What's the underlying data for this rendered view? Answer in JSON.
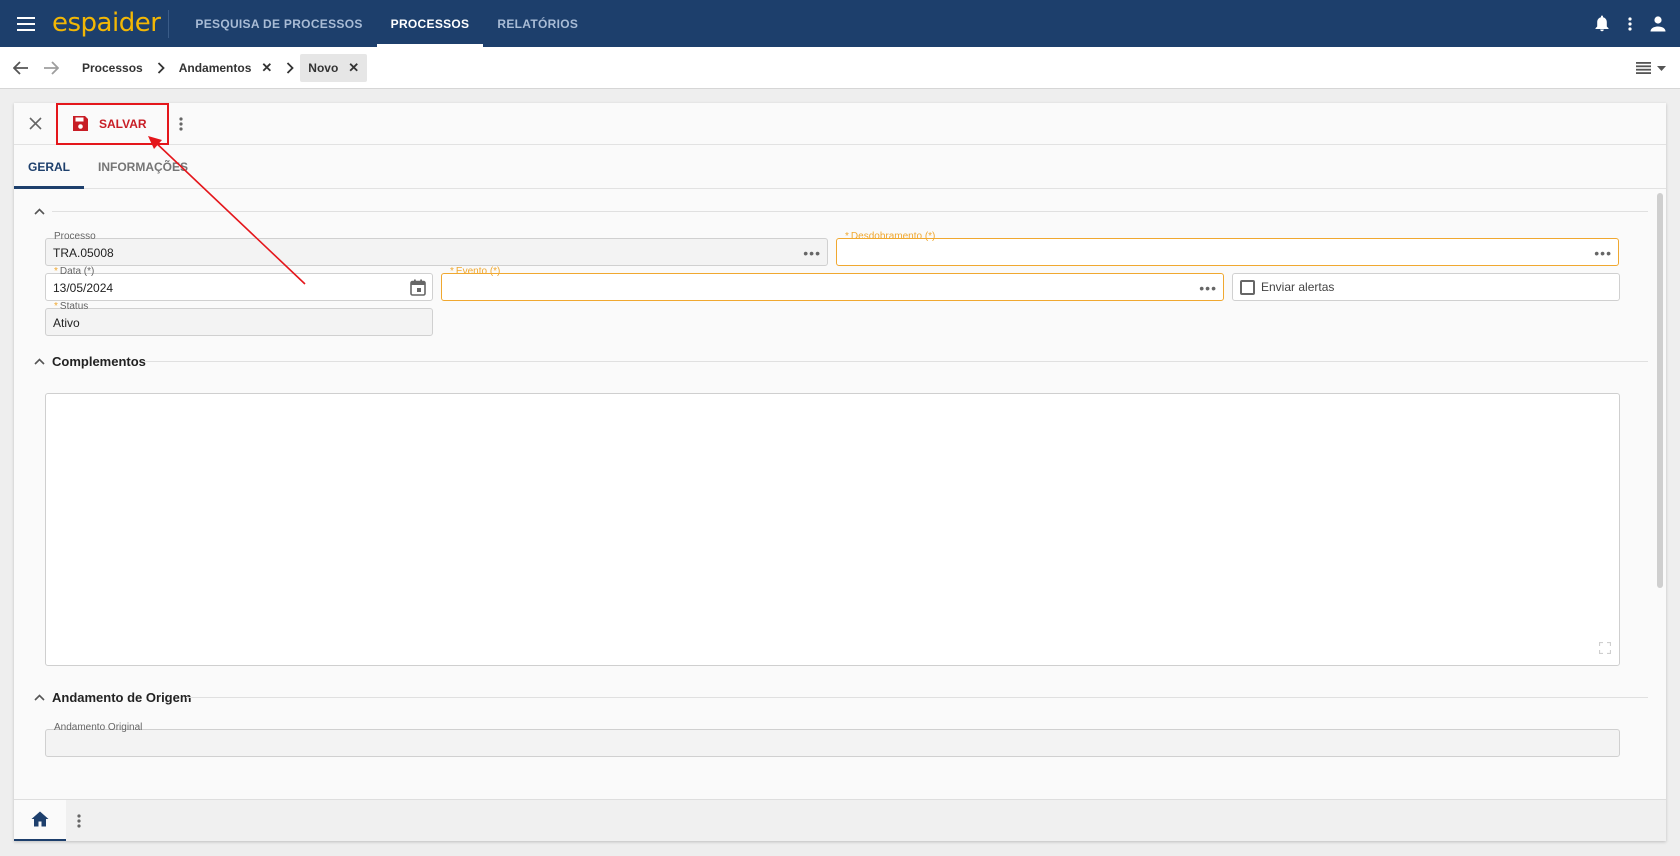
{
  "app": {
    "logo": "espaider"
  },
  "nav": [
    {
      "label": "PESQUISA DE PROCESSOS",
      "active": false
    },
    {
      "label": "PROCESSOS",
      "active": true
    },
    {
      "label": "RELATÓRIOS",
      "active": false
    }
  ],
  "breadcrumb": {
    "items": [
      "Processos",
      "Andamentos",
      "Novo"
    ]
  },
  "toolbar": {
    "save_label": "SALVAR"
  },
  "tabs": [
    {
      "label": "GERAL",
      "active": true
    },
    {
      "label": "INFORMAÇÕES",
      "active": false
    }
  ],
  "form": {
    "processo": {
      "label": "Processo",
      "value": "TRA.05008"
    },
    "desdobramento": {
      "label": "Desdobramento (*)",
      "value": ""
    },
    "data": {
      "label": "Data (*)",
      "value": "13/05/2024"
    },
    "evento": {
      "label": "Evento (*)",
      "value": ""
    },
    "enviar_alertas": {
      "label": "Enviar alertas",
      "checked": false
    },
    "status": {
      "label": "Status",
      "value": "Ativo"
    }
  },
  "sections": {
    "complementos": "Complementos",
    "andamento_origem": "Andamento de Origem"
  },
  "andamento_original": {
    "label": "Andamento Original",
    "value": ""
  },
  "colors": {
    "primary": "#1d3f6c",
    "accent": "#f2b705",
    "required": "#f0a830",
    "save": "#c81d25",
    "annotation": "#e4161b"
  },
  "icons": [
    "menu-icon",
    "bell-icon",
    "more-vert-icon",
    "user-icon",
    "arrow-back-icon",
    "arrow-forward-icon",
    "list-view-icon",
    "close-icon",
    "save-icon",
    "calendar-icon",
    "chevron-up-icon",
    "home-icon",
    "expand-icon"
  ]
}
